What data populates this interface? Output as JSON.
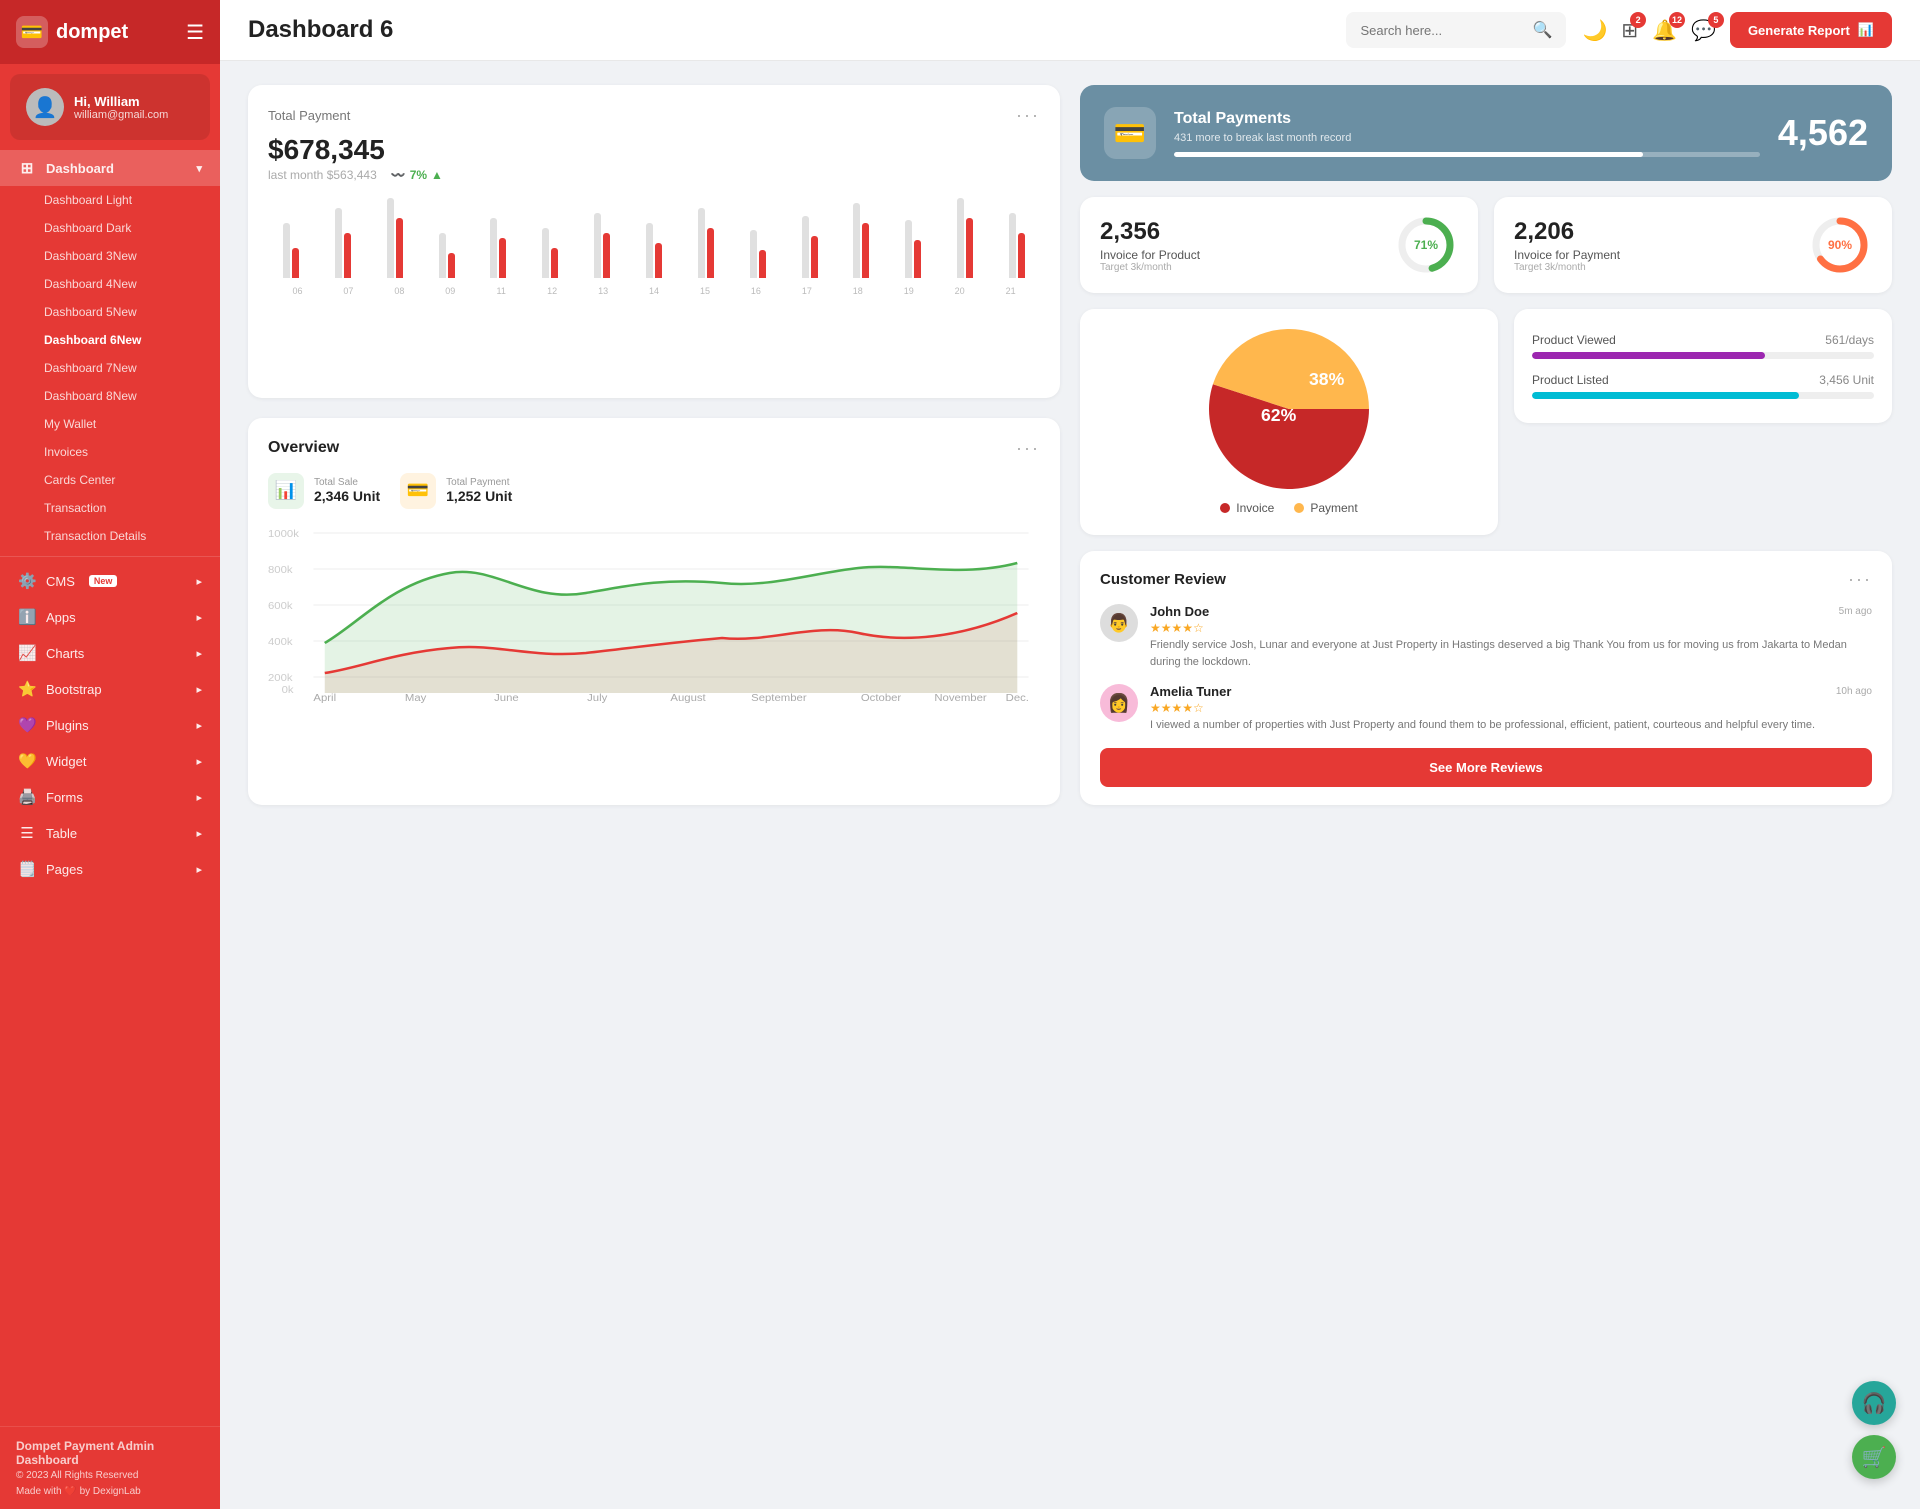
{
  "app": {
    "name": "dompet",
    "logo_icon": "💳"
  },
  "user": {
    "greeting": "Hi, William",
    "email": "william@gmail.com",
    "avatar_icon": "👤"
  },
  "sidebar": {
    "dashboard_label": "Dashboard",
    "items": [
      {
        "id": "dashboard-light",
        "label": "Dashboard Light",
        "sub": true,
        "badge": null,
        "active": false
      },
      {
        "id": "dashboard-dark",
        "label": "Dashboard Dark",
        "sub": true,
        "badge": null,
        "active": false
      },
      {
        "id": "dashboard-3",
        "label": "Dashboard 3",
        "sub": true,
        "badge": "New",
        "active": false
      },
      {
        "id": "dashboard-4",
        "label": "Dashboard 4",
        "sub": true,
        "badge": "New",
        "active": false
      },
      {
        "id": "dashboard-5",
        "label": "Dashboard 5",
        "sub": true,
        "badge": "New",
        "active": false
      },
      {
        "id": "dashboard-6",
        "label": "Dashboard 6",
        "sub": true,
        "badge": "New",
        "active": true
      },
      {
        "id": "dashboard-7",
        "label": "Dashboard 7",
        "sub": true,
        "badge": "New",
        "active": false
      },
      {
        "id": "dashboard-8",
        "label": "Dashboard 8",
        "sub": true,
        "badge": "New",
        "active": false
      },
      {
        "id": "my-wallet",
        "label": "My Wallet",
        "sub": true,
        "badge": null,
        "active": false
      },
      {
        "id": "invoices",
        "label": "Invoices",
        "sub": true,
        "badge": null,
        "active": false
      },
      {
        "id": "cards-center",
        "label": "Cards Center",
        "sub": true,
        "badge": null,
        "active": false
      },
      {
        "id": "transaction",
        "label": "Transaction",
        "sub": true,
        "badge": null,
        "active": false
      },
      {
        "id": "transaction-details",
        "label": "Transaction Details",
        "sub": true,
        "badge": null,
        "active": false
      }
    ],
    "main_items": [
      {
        "id": "cms",
        "label": "CMS",
        "icon": "⚙️",
        "badge": "New",
        "has_arrow": true
      },
      {
        "id": "apps",
        "label": "Apps",
        "icon": "ℹ️",
        "badge": null,
        "has_arrow": true
      },
      {
        "id": "charts",
        "label": "Charts",
        "icon": "📈",
        "badge": null,
        "has_arrow": true
      },
      {
        "id": "bootstrap",
        "label": "Bootstrap",
        "icon": "⭐",
        "badge": null,
        "has_arrow": true
      },
      {
        "id": "plugins",
        "label": "Plugins",
        "icon": "💜",
        "badge": null,
        "has_arrow": true
      },
      {
        "id": "widget",
        "label": "Widget",
        "icon": "💛",
        "badge": null,
        "has_arrow": true
      },
      {
        "id": "forms",
        "label": "Forms",
        "icon": "🖨️",
        "badge": null,
        "has_arrow": true
      },
      {
        "id": "table",
        "label": "Table",
        "icon": "☰",
        "badge": null,
        "has_arrow": true
      },
      {
        "id": "pages",
        "label": "Pages",
        "icon": "🗒️",
        "badge": null,
        "has_arrow": true
      }
    ],
    "footer": {
      "title": "Dompet Payment Admin Dashboard",
      "copy": "© 2023 All Rights Reserved",
      "made": "Made with ❤️ by DexignLab"
    }
  },
  "topbar": {
    "title": "Dashboard 6",
    "search_placeholder": "Search here...",
    "icons": {
      "moon_label": "dark-mode",
      "apps_badge": "2",
      "bell_badge": "12",
      "message_badge": "5"
    },
    "generate_btn": "Generate Report"
  },
  "total_payment": {
    "title": "Total Payment",
    "amount": "$678,345",
    "last_month": "last month $563,443",
    "trend_pct": "7%",
    "bars": [
      {
        "label": "06",
        "gray": 55,
        "red": 30
      },
      {
        "label": "07",
        "gray": 70,
        "red": 45
      },
      {
        "label": "08",
        "gray": 80,
        "red": 60
      },
      {
        "label": "09",
        "gray": 45,
        "red": 25
      },
      {
        "label": "11",
        "gray": 60,
        "red": 40
      },
      {
        "label": "12",
        "gray": 50,
        "red": 30
      },
      {
        "label": "13",
        "gray": 65,
        "red": 45
      },
      {
        "label": "14",
        "gray": 55,
        "red": 35
      },
      {
        "label": "15",
        "gray": 70,
        "red": 50
      },
      {
        "label": "16",
        "gray": 48,
        "red": 28
      },
      {
        "label": "17",
        "gray": 62,
        "red": 42
      },
      {
        "label": "18",
        "gray": 75,
        "red": 55
      },
      {
        "label": "19",
        "gray": 58,
        "red": 38
      },
      {
        "label": "20",
        "gray": 80,
        "red": 60
      },
      {
        "label": "21",
        "gray": 65,
        "red": 45
      }
    ]
  },
  "banner": {
    "title": "Total Payments",
    "sub": "431 more to break last month record",
    "count": "4,562",
    "progress": 80,
    "icon": "💳"
  },
  "invoice_product": {
    "number": "2,356",
    "label": "Invoice for Product",
    "target": "Target 3k/month",
    "percent": 71,
    "color": "#4caf50"
  },
  "invoice_payment": {
    "number": "2,206",
    "label": "Invoice for Payment",
    "target": "Target 3k/month",
    "percent": 90,
    "color": "#ff7043"
  },
  "overview": {
    "title": "Overview",
    "total_sale_label": "Total Sale",
    "total_sale_value": "2,346 Unit",
    "total_payment_label": "Total Payment",
    "total_payment_value": "1,252 Unit",
    "months": [
      "April",
      "May",
      "June",
      "July",
      "August",
      "September",
      "October",
      "November",
      "Dec."
    ],
    "y_labels": [
      "1000k",
      "800k",
      "600k",
      "400k",
      "200k",
      "0k"
    ]
  },
  "pie": {
    "invoice_pct": 62,
    "payment_pct": 38,
    "invoice_label": "Invoice",
    "payment_label": "Payment",
    "invoice_color": "#c62828",
    "payment_color": "#ffb74d"
  },
  "product_metrics": [
    {
      "label": "Product Viewed",
      "value": "561/days",
      "fill_pct": 68,
      "color": "#9c27b0"
    },
    {
      "label": "Product Listed",
      "value": "3,456 Unit",
      "fill_pct": 78,
      "color": "#00bcd4"
    }
  ],
  "reviews": {
    "title": "Customer Review",
    "see_more": "See More Reviews",
    "items": [
      {
        "name": "John Doe",
        "stars": 4,
        "time": "5m ago",
        "text": "Friendly service Josh, Lunar and everyone at Just Property in Hastings deserved a big Thank You from us for moving us from Jakarta to Medan during the lockdown.",
        "avatar_icon": "👨"
      },
      {
        "name": "Amelia Tuner",
        "stars": 4,
        "time": "10h ago",
        "text": "I viewed a number of properties with Just Property and found them to be professional, efficient, patient, courteous and helpful every time.",
        "avatar_icon": "👩"
      }
    ]
  },
  "float_btns": {
    "support_icon": "🎧",
    "cart_icon": "🛒"
  }
}
